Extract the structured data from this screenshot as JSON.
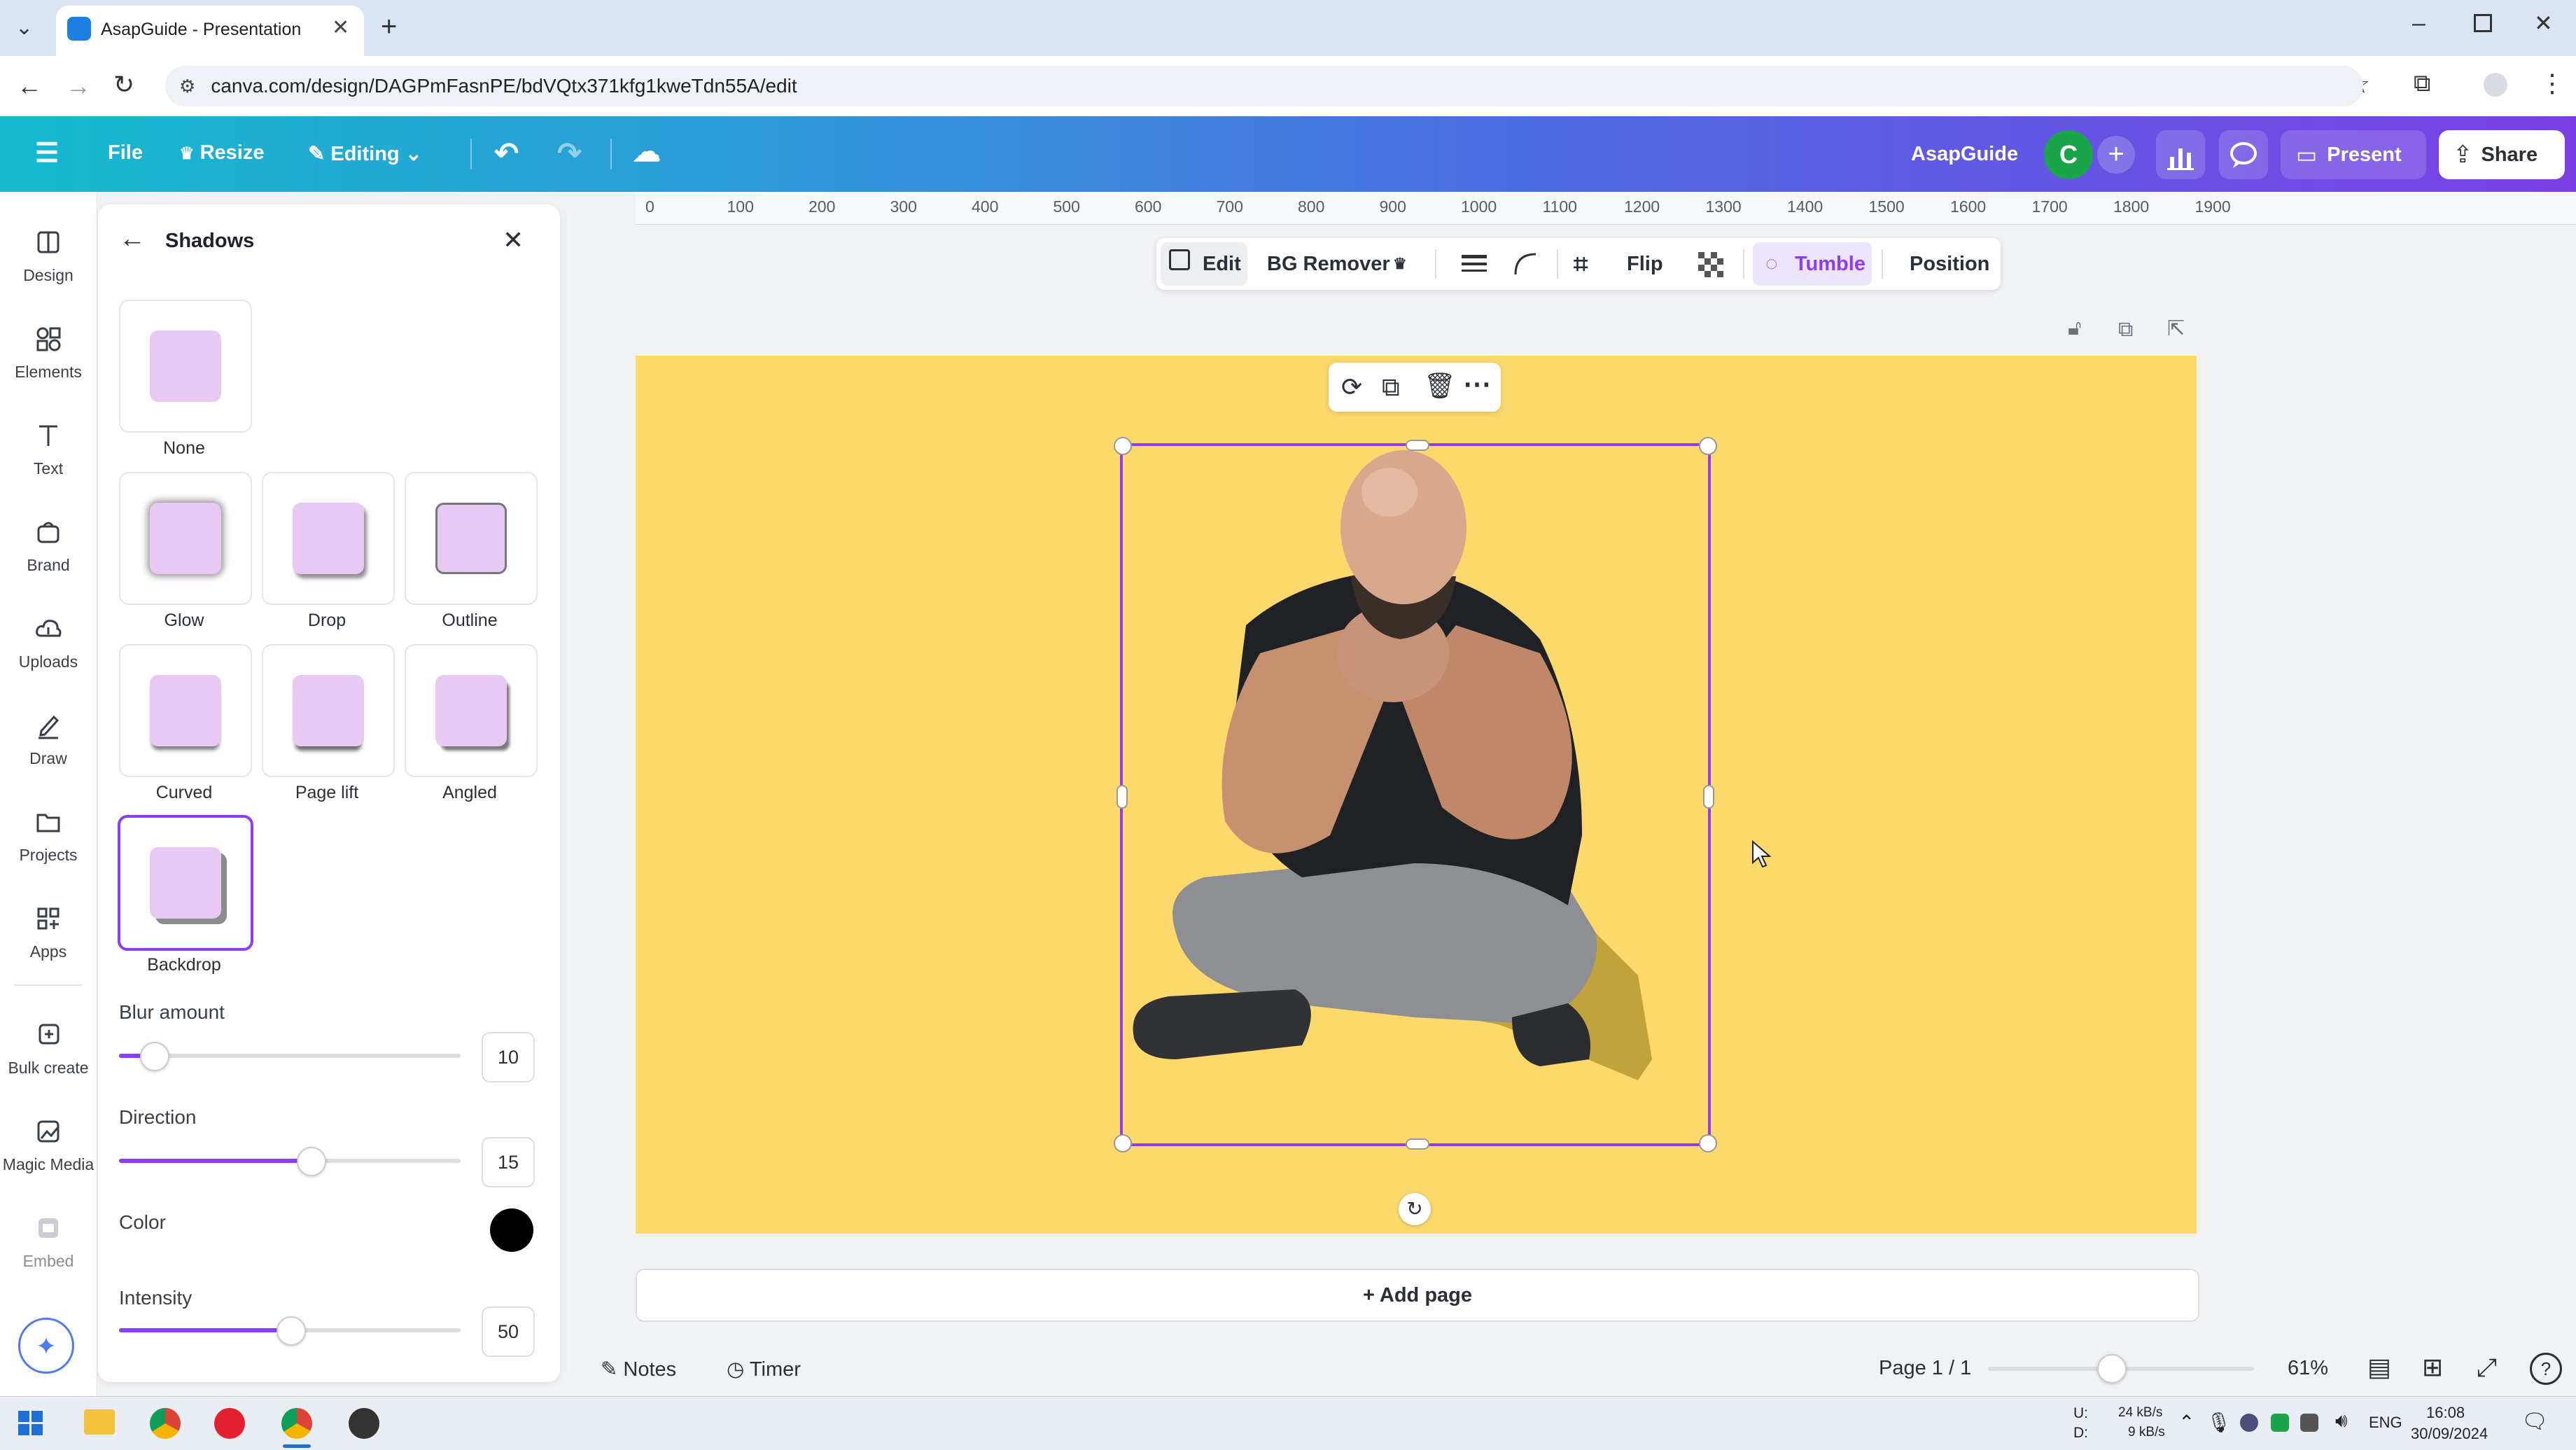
{
  "browser": {
    "tab_title": "AsapGuide - Presentation",
    "url": "canva.com/design/DAGPmFasnPE/bdVQtx371kfg1kweTdn55A/edit"
  },
  "header": {
    "file": "File",
    "resize": "Resize",
    "editing": "Editing",
    "team_name": "AsapGuide",
    "avatar_letter": "C",
    "present": "Present",
    "share": "Share"
  },
  "rail": {
    "items": [
      "Design",
      "Elements",
      "Text",
      "Brand",
      "Uploads",
      "Draw",
      "Projects",
      "Apps",
      "Bulk create",
      "Magic Media",
      "Embed"
    ]
  },
  "panel": {
    "title": "Shadows",
    "presets": [
      "None",
      "Glow",
      "Drop",
      "Outline",
      "Curved",
      "Page lift",
      "Angled",
      "Backdrop"
    ],
    "selected_preset": "Backdrop",
    "blur_label": "Blur amount",
    "blur_value": "10",
    "blur_fraction": 0.1,
    "direction_label": "Direction",
    "direction_value": "15",
    "direction_fraction": 0.56,
    "color_label": "Color",
    "color_value": "#000000",
    "intensity_label": "Intensity",
    "intensity_value": "50",
    "intensity_fraction": 0.5
  },
  "ruler": {
    "ticks": [
      "0",
      "100",
      "200",
      "300",
      "400",
      "500",
      "600",
      "700",
      "800",
      "900",
      "1000",
      "1100",
      "1200",
      "1300",
      "1400",
      "1500",
      "1600",
      "1700",
      "1800",
      "1900"
    ]
  },
  "toolbar": {
    "edit": "Edit",
    "bg_remover": "BG Remover",
    "flip": "Flip",
    "tumble": "Tumble",
    "position": "Position"
  },
  "canvas": {
    "background_color": "#fdd96c",
    "add_page": "+ Add page"
  },
  "bottom": {
    "notes": "Notes",
    "timer": "Timer",
    "page_indicator": "Page 1 / 1",
    "zoom": "61%",
    "zoom_fraction": 0.46
  },
  "taskbar": {
    "net_up_label": "U:",
    "net_down_label": "D:",
    "net_up": "24 kB/s",
    "net_down": "9 kB/s",
    "language": "ENG",
    "time": "16:08",
    "date": "30/09/2024"
  },
  "colors": {
    "accent": "#8b3dff",
    "avatar": "#1aa548"
  }
}
